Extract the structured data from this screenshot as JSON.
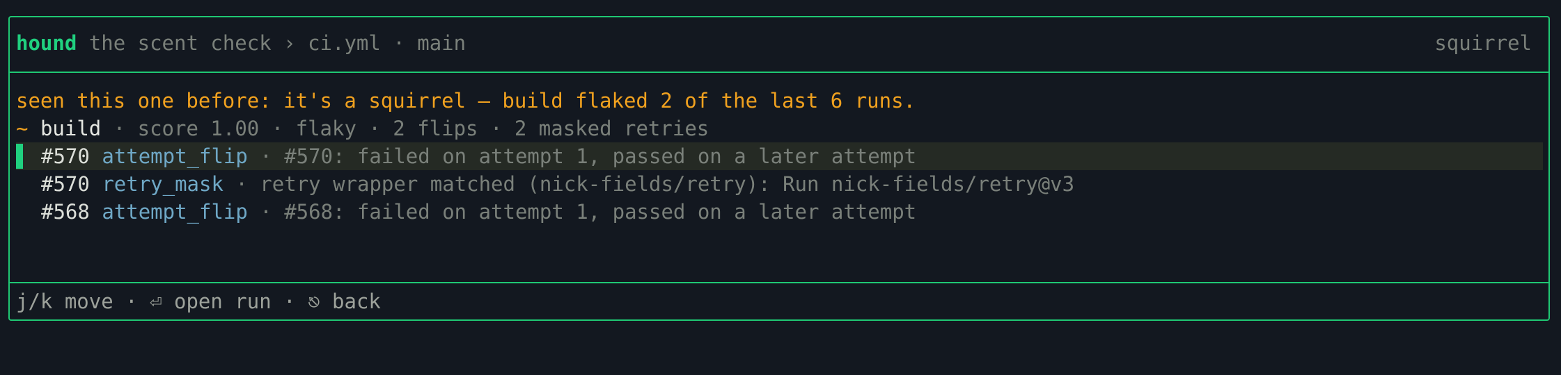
{
  "header": {
    "brand": "hound",
    "subtitle": "the scent check",
    "separator": "›",
    "workflow": "ci.yml",
    "dot": "·",
    "branch": "main",
    "right_label": "squirrel"
  },
  "verdict": "seen this one before: it's a squirrel — build flaked 2 of the last 6 runs.",
  "summary": {
    "marker": "~",
    "job": "build",
    "details": "· score 1.00 · flaky · 2 flips · 2 masked retries"
  },
  "events": [
    {
      "run": "#570",
      "kind": "attempt_flip",
      "detail": "· #570: failed on attempt 1, passed on a later attempt",
      "selected": true
    },
    {
      "run": "#570",
      "kind": "retry_mask",
      "detail": "· retry wrapper matched (nick-fields/retry): Run nick-fields/retry@v3",
      "selected": false
    },
    {
      "run": "#568",
      "kind": "attempt_flip",
      "detail": "· #568: failed on attempt 1, passed on a later attempt",
      "selected": false
    }
  ],
  "footer": {
    "move": "j/k move",
    "open": "⏎ open run",
    "back": "⎋ back",
    "dot": "·"
  },
  "colors": {
    "accent": "#20d07f",
    "warning": "#f0a11f",
    "link": "#6fa8c6",
    "background": "#131820"
  }
}
